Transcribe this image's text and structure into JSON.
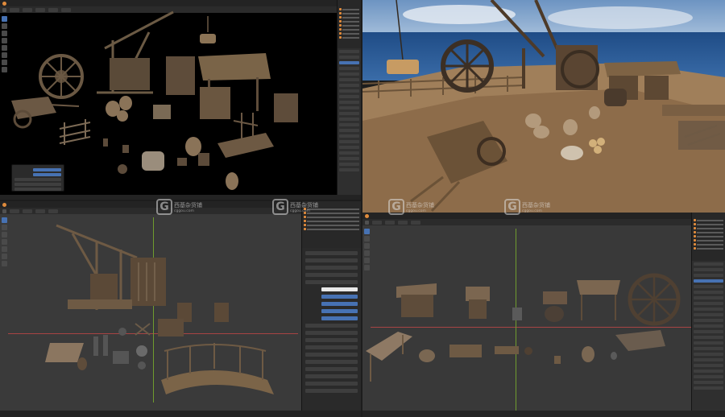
{
  "watermark": {
    "logo_letter": "G",
    "brand": "西基杂货铺",
    "domain": "cggou.com"
  },
  "colors": {
    "accent_blue": "#4772b3",
    "viewport_gray": "#3a3a3a",
    "object_orange": "#e08b3c",
    "axis_red": "#a84444",
    "axis_green": "#6f9c2e"
  },
  "icons": [
    "select-box-icon",
    "cursor-icon",
    "move-icon",
    "rotate-icon",
    "scale-icon",
    "transform-icon",
    "annotate-icon",
    "measure-icon"
  ]
}
